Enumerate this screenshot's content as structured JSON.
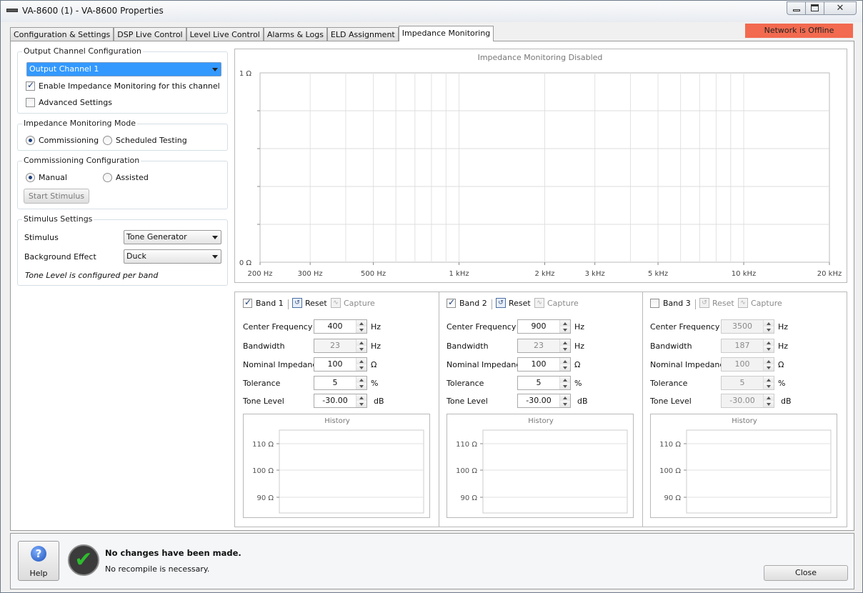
{
  "window": {
    "title": "VA-8600 (1) - VA-8600 Properties",
    "close_glyph": "✕"
  },
  "tabs": [
    {
      "label": "Configuration & Settings"
    },
    {
      "label": "DSP Live Control"
    },
    {
      "label": "Level Live Control"
    },
    {
      "label": "Alarms & Logs"
    },
    {
      "label": "ELD Assignment"
    },
    {
      "label": "Impedance Monitoring",
      "active": true
    }
  ],
  "network_status": {
    "label": "Network is Offline",
    "color": "#f26a4f"
  },
  "output_channel": {
    "group_label": "Output Channel Configuration",
    "selected": "Output Channel 1",
    "enable_label": "Enable Impedance Monitoring for this channel",
    "enable_checked": true,
    "advanced_label": "Advanced Settings",
    "advanced_checked": false
  },
  "mode": {
    "group_label": "Impedance Monitoring Mode",
    "options": [
      "Commissioning",
      "Scheduled Testing"
    ],
    "selected": "Commissioning"
  },
  "commissioning": {
    "group_label": "Commissioning Configuration",
    "options": [
      "Manual",
      "Assisted"
    ],
    "selected": "Manual",
    "start_button": "Start Stimulus"
  },
  "stimulus": {
    "group_label": "Stimulus Settings",
    "stimulus_label": "Stimulus",
    "stimulus_value": "Tone Generator",
    "background_label": "Background Effect",
    "background_value": "Duck",
    "note": "Tone Level is configured per band"
  },
  "chart_data": {
    "type": "line",
    "title": "Impedance Monitoring Disabled",
    "x_scale": "log",
    "xlim": [
      200,
      20000
    ],
    "ylim": [
      0,
      1
    ],
    "x_ticks": [
      "200 Hz",
      "300 Hz",
      "500 Hz",
      "1 kHz",
      "2 kHz",
      "3 kHz",
      "5 kHz",
      "10 kHz",
      "20 kHz"
    ],
    "y_ticks": [
      "0 Ω",
      "1 Ω"
    ],
    "grid": true,
    "series": []
  },
  "bands": [
    {
      "name": "Band 1",
      "enabled": true,
      "reset": "Reset",
      "capture": "Capture",
      "fields": [
        {
          "label": "Center Frequency",
          "value": "400",
          "unit": "Hz",
          "editable": true
        },
        {
          "label": "Bandwidth",
          "value": "23",
          "unit": "Hz",
          "editable": false
        },
        {
          "label": "Nominal Impedance",
          "value": "100",
          "unit": "Ω",
          "editable": true
        },
        {
          "label": "Tolerance",
          "value": "5",
          "unit": "%",
          "editable": true
        },
        {
          "label": "Tone Level",
          "value": "-30.00",
          "unit": "dB",
          "editable": true
        }
      ],
      "history": {
        "title": "History",
        "y_ticks": [
          "110 Ω",
          "100 Ω",
          "90 Ω"
        ]
      }
    },
    {
      "name": "Band 2",
      "enabled": true,
      "reset": "Reset",
      "capture": "Capture",
      "fields": [
        {
          "label": "Center Frequency",
          "value": "900",
          "unit": "Hz",
          "editable": true
        },
        {
          "label": "Bandwidth",
          "value": "23",
          "unit": "Hz",
          "editable": false
        },
        {
          "label": "Nominal Impedance",
          "value": "100",
          "unit": "Ω",
          "editable": true
        },
        {
          "label": "Tolerance",
          "value": "5",
          "unit": "%",
          "editable": true
        },
        {
          "label": "Tone Level",
          "value": "-30.00",
          "unit": "dB",
          "editable": true
        }
      ],
      "history": {
        "title": "History",
        "y_ticks": [
          "110 Ω",
          "100 Ω",
          "90 Ω"
        ]
      }
    },
    {
      "name": "Band 3",
      "enabled": false,
      "reset": "Reset",
      "capture": "Capture",
      "fields": [
        {
          "label": "Center Frequency",
          "value": "3500",
          "unit": "Hz",
          "editable": false
        },
        {
          "label": "Bandwidth",
          "value": "187",
          "unit": "Hz",
          "editable": false
        },
        {
          "label": "Nominal Impedance",
          "value": "100",
          "unit": "Ω",
          "editable": false
        },
        {
          "label": "Tolerance",
          "value": "5",
          "unit": "%",
          "editable": false
        },
        {
          "label": "Tone Level",
          "value": "-30.00",
          "unit": "dB",
          "editable": false
        }
      ],
      "history": {
        "title": "History",
        "y_ticks": [
          "110 Ω",
          "100 Ω",
          "90 Ω"
        ]
      }
    }
  ],
  "footer": {
    "help_label": "Help",
    "help_glyph": "?",
    "status_title": "No changes have been made.",
    "status_detail": "No recompile is necessary.",
    "close_label": "Close"
  }
}
